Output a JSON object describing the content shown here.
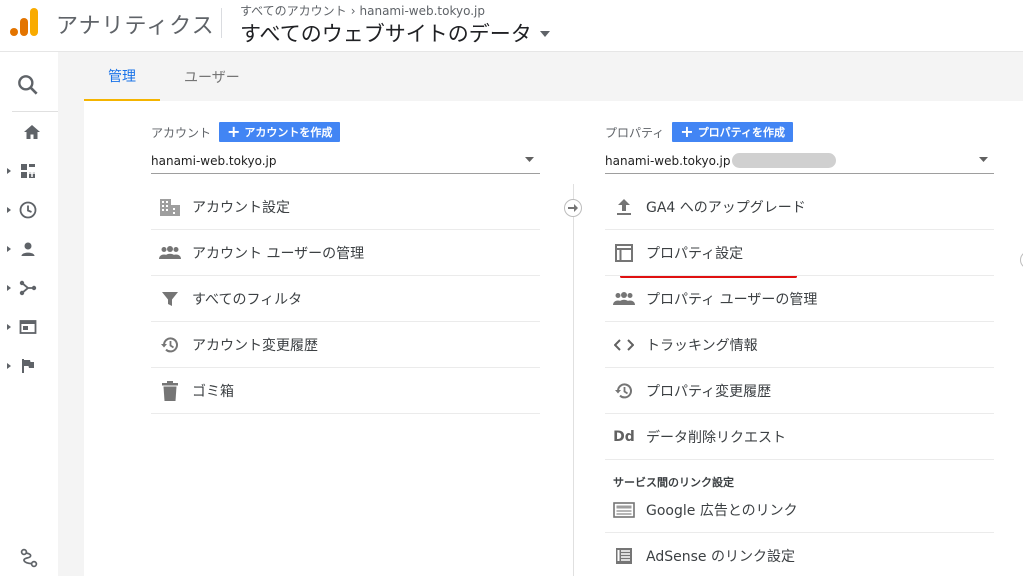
{
  "header": {
    "app_title": "アナリティクス",
    "breadcrumb": [
      "すべてのアカウント",
      "hanami-web.tokyo.jp"
    ],
    "view_name": "すべてのウェブサイトのデータ"
  },
  "tabs": [
    {
      "label": "管理",
      "active": true
    },
    {
      "label": "ユーザー",
      "active": false
    }
  ],
  "account": {
    "heading": "アカウント",
    "create_label": "アカウントを作成",
    "selected": "hanami-web.tokyo.jp",
    "items": [
      {
        "label": "アカウント設定",
        "icon": "building-icon"
      },
      {
        "label": "アカウント ユーザーの管理",
        "icon": "people-icon"
      },
      {
        "label": "すべてのフィルタ",
        "icon": "filter-icon"
      },
      {
        "label": "アカウント変更履歴",
        "icon": "history-icon"
      },
      {
        "label": "ゴミ箱",
        "icon": "trash-icon"
      }
    ]
  },
  "property": {
    "heading": "プロパティ",
    "create_label": "プロパティを作成",
    "selected": "hanami-web.tokyo.jp",
    "items": [
      {
        "label": "GA4 へのアップグレード",
        "icon": "upload-icon"
      },
      {
        "label": "プロパティ設定",
        "icon": "layout-icon"
      },
      {
        "label": "プロパティ ユーザーの管理",
        "icon": "people-icon"
      },
      {
        "label": "トラッキング情報",
        "icon": "code-icon"
      },
      {
        "label": "プロパティ変更履歴",
        "icon": "history-icon"
      },
      {
        "label": "データ削除リクエスト",
        "icon": "dd-icon"
      }
    ],
    "section_label": "サービス間のリンク設定",
    "link_items": [
      {
        "label": "Google 広告とのリンク",
        "icon": "ads-icon"
      },
      {
        "label": "AdSense のリンク設定",
        "icon": "adsense-icon"
      }
    ],
    "dd_glyph": "Dd"
  },
  "colors": {
    "accent": "#1a73e8",
    "button": "#4285f4",
    "tab_underline": "#f4b400",
    "highlight": "#e01010"
  }
}
